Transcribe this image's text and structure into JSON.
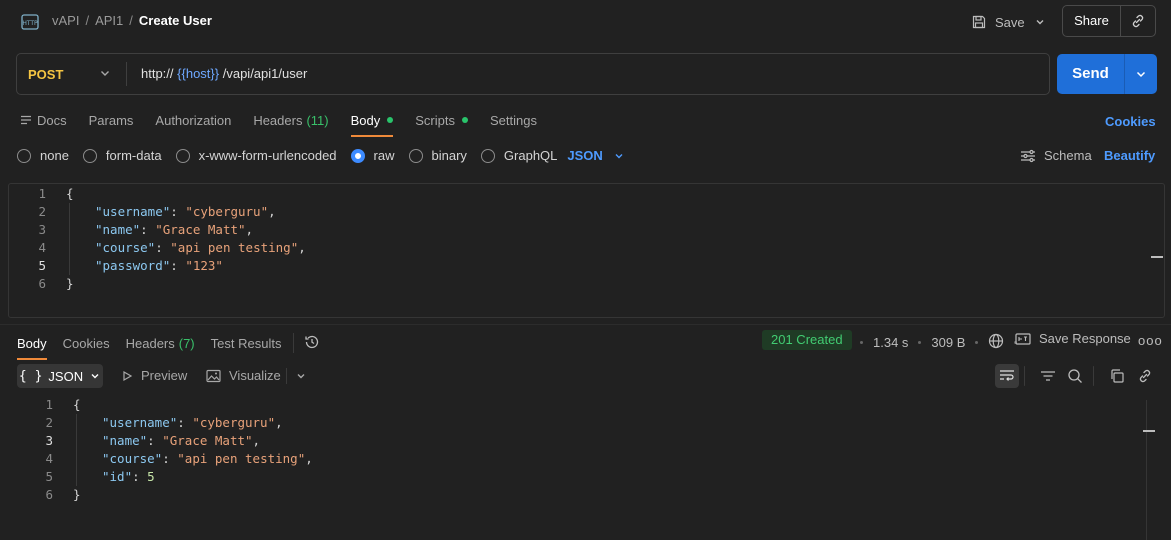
{
  "header": {
    "breadcrumb": [
      "vAPI",
      "API1"
    ],
    "title": "Create User",
    "save_label": "Save",
    "share_label": "Share"
  },
  "request": {
    "method": "POST",
    "url_prefix": "http://",
    "url_var": "{{host}}",
    "url_path": "/vapi/api1/user",
    "send_label": "Send"
  },
  "req_tabs": {
    "docs": "Docs",
    "params": "Params",
    "authorization": "Authorization",
    "headers": "Headers",
    "headers_count": "(11)",
    "body": "Body",
    "scripts": "Scripts",
    "settings": "Settings",
    "cookies": "Cookies"
  },
  "body_types": {
    "none": "none",
    "form_data": "form-data",
    "urlencoded": "x-www-form-urlencoded",
    "raw": "raw",
    "binary": "binary",
    "graphql": "GraphQL",
    "format": "JSON",
    "schema": "Schema",
    "beautify": "Beautify"
  },
  "request_body": [
    {
      "ln": "1",
      "indent": 0,
      "parts": [
        [
          "p",
          "{"
        ]
      ]
    },
    {
      "ln": "2",
      "indent": 1,
      "parts": [
        [
          "k",
          "\"username\""
        ],
        [
          "p",
          ": "
        ],
        [
          "s",
          "\"cyberguru\""
        ],
        [
          "p",
          ","
        ]
      ]
    },
    {
      "ln": "3",
      "indent": 1,
      "parts": [
        [
          "k",
          "\"name\""
        ],
        [
          "p",
          ": "
        ],
        [
          "s",
          "\"Grace Matt\""
        ],
        [
          "p",
          ","
        ]
      ]
    },
    {
      "ln": "4",
      "indent": 1,
      "parts": [
        [
          "k",
          "\"course\""
        ],
        [
          "p",
          ": "
        ],
        [
          "s",
          "\"api pen testing\""
        ],
        [
          "p",
          ","
        ]
      ]
    },
    {
      "ln": "5",
      "indent": 1,
      "parts": [
        [
          "k",
          "\"password\""
        ],
        [
          "p",
          ": "
        ],
        [
          "s",
          "\"123\""
        ]
      ]
    },
    {
      "ln": "6",
      "indent": 0,
      "parts": [
        [
          "p",
          "}"
        ]
      ]
    }
  ],
  "resp_tabs": {
    "body": "Body",
    "cookies": "Cookies",
    "headers": "Headers",
    "headers_count": "(7)",
    "test_results": "Test Results"
  },
  "response_meta": {
    "status": "201 Created",
    "time": "1.34 s",
    "size": "309 B",
    "save_response": "Save Response",
    "more": "ooo",
    "status_color": "#42cc72"
  },
  "resp_toolbar": {
    "format": "JSON",
    "preview": "Preview",
    "visualize": "Visualize"
  },
  "response_body": [
    {
      "ln": "1",
      "indent": 0,
      "parts": [
        [
          "p",
          "{"
        ]
      ]
    },
    {
      "ln": "2",
      "indent": 1,
      "parts": [
        [
          "k",
          "\"username\""
        ],
        [
          "p",
          ": "
        ],
        [
          "s",
          "\"cyberguru\""
        ],
        [
          "p",
          ","
        ]
      ]
    },
    {
      "ln": "3",
      "indent": 1,
      "parts": [
        [
          "k",
          "\"name\""
        ],
        [
          "p",
          ": "
        ],
        [
          "s",
          "\"Grace Matt\""
        ],
        [
          "p",
          ","
        ]
      ]
    },
    {
      "ln": "4",
      "indent": 1,
      "parts": [
        [
          "k",
          "\"course\""
        ],
        [
          "p",
          ": "
        ],
        [
          "s",
          "\"api pen testing\""
        ],
        [
          "p",
          ","
        ]
      ]
    },
    {
      "ln": "5",
      "indent": 1,
      "parts": [
        [
          "k",
          "\"id\""
        ],
        [
          "p",
          ": "
        ],
        [
          "n",
          "5"
        ]
      ]
    },
    {
      "ln": "6",
      "indent": 0,
      "parts": [
        [
          "p",
          "}"
        ]
      ]
    }
  ]
}
